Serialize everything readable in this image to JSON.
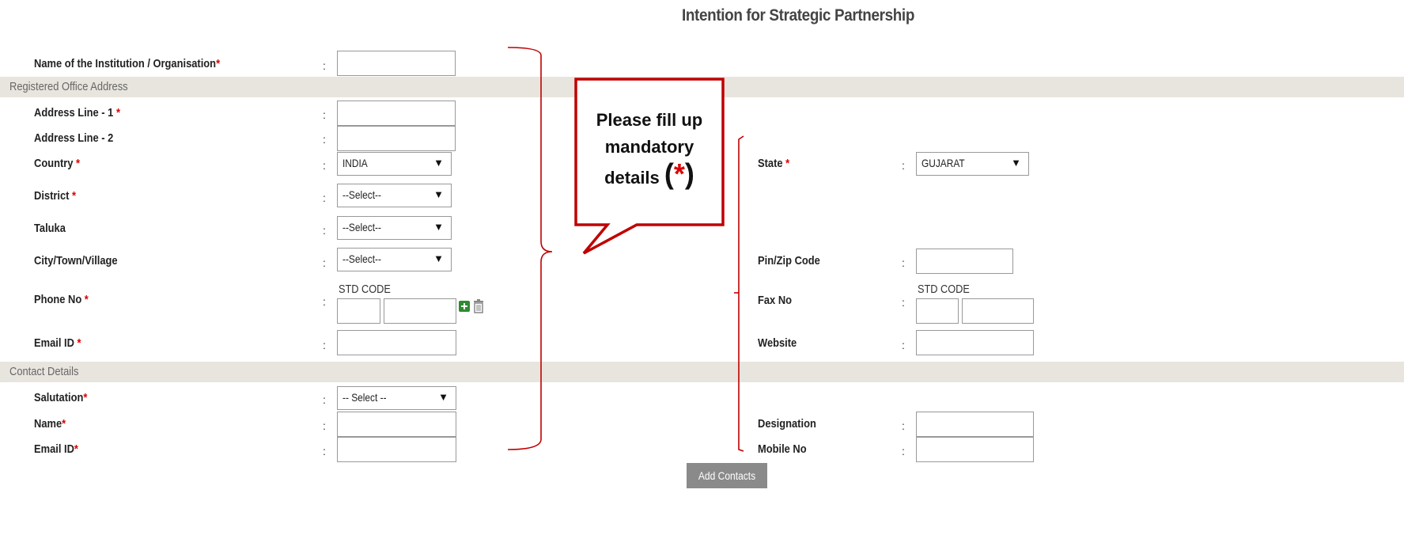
{
  "title": "Intention for Strategic Partnership",
  "req_mark": "*",
  "colon": ":",
  "institution": {
    "label": "Name of the Institution / Organisation"
  },
  "sections": {
    "registered_office": "Registered Office Address",
    "contact_details": "Contact Details"
  },
  "address": {
    "line1": "Address Line - 1",
    "line2": "Address Line - 2",
    "country": "Country",
    "country_value": "INDIA",
    "district": "District",
    "district_value": "--Select--",
    "taluka": "Taluka",
    "taluka_value": "--Select--",
    "city": "City/Town/Village",
    "city_value": "--Select--",
    "phone": "Phone No",
    "std_code": "STD CODE",
    "email": "Email ID",
    "state": "State",
    "state_value": "GUJARAT",
    "pin": "Pin/Zip Code",
    "fax": "Fax No",
    "website": "Website"
  },
  "contact": {
    "salutation": "Salutation",
    "salutation_value": "-- Select --",
    "name": "Name",
    "email": "Email ID",
    "designation": "Designation",
    "mobile": "Mobile No",
    "add_button": "Add Contacts"
  },
  "callout": {
    "line1": "Please fill up",
    "line2": "mandatory",
    "line3": "details",
    "open": "(",
    "star": "*",
    "close": ")"
  },
  "icons": {
    "add": "plus-icon",
    "delete": "trash-icon"
  },
  "colors": {
    "accent_red": "#c00000",
    "required": "#dd0000",
    "section_bg": "#e8e5de",
    "button_bg": "#8a8a8a"
  }
}
